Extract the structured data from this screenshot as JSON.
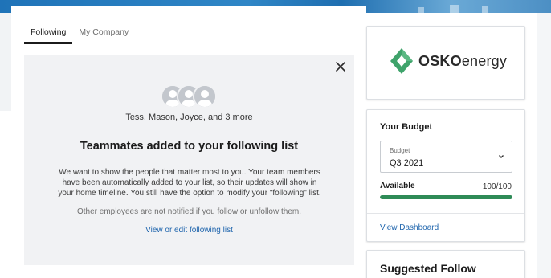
{
  "tabs": [
    {
      "label": "Following",
      "active": true
    },
    {
      "label": "My Company",
      "active": false
    }
  ],
  "notice": {
    "names": "Tess, Mason, Joyce, and 3 more",
    "title": "Teammates added to your following list",
    "body": "We want to show the people that matter most to you. Your team members have been automatically added to your list, so their updates will show in your home timeline. You still have the option to modify your \"following\" list.",
    "note": "Other employees are not notified if you follow or unfollow them.",
    "link": "View or edit following list",
    "close_icon": "close-icon",
    "avatar_icon": "person-avatar-icon"
  },
  "company": {
    "logo_bold": "OSKO",
    "logo_light": "energy",
    "logo_color": "#3fa36b"
  },
  "budget": {
    "title": "Your Budget",
    "select_label": "Budget",
    "select_value": "Q3 2021",
    "available_label": "Available",
    "available_count": "100/100",
    "progress_fraction": 1.0,
    "progress_color": "#2e8b57",
    "dashboard_link": "View Dashboard"
  },
  "suggested": {
    "title": "Suggested Follow"
  },
  "colors": {
    "link": "#1f65ad",
    "banner": "#1f73b8"
  }
}
